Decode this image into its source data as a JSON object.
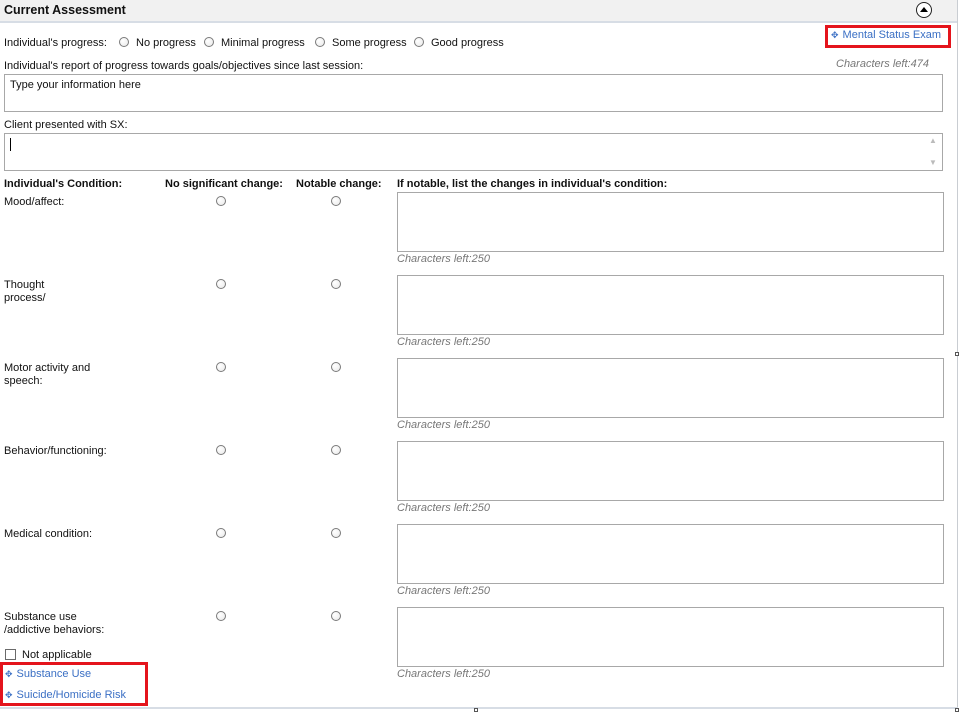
{
  "section": {
    "title": "Current Assessment"
  },
  "mental_status_exam": {
    "label": "Mental Status Exam"
  },
  "progress": {
    "label": "Individual's progress:",
    "options": [
      "No progress",
      "Minimal progress",
      "Some progress",
      "Good progress"
    ]
  },
  "report": {
    "label": "Individual's report of progress towards goals/objectives since last session:",
    "chars_left": "Characters left:474",
    "value": "Type your information here"
  },
  "sx": {
    "label": "Client presented with SX:"
  },
  "condition": {
    "headers": {
      "condition": "Individual's Condition:",
      "no_change": "No significant change:",
      "notable": "Notable change:",
      "list": "If notable, list the changes in individual's condition:"
    },
    "rows": [
      {
        "label": "Mood/affect:",
        "chars_left": "Characters left:250"
      },
      {
        "label": "Thought process/",
        "chars_left": "Characters left:250"
      },
      {
        "label": "Motor activity and speech:",
        "chars_left": "Characters left:250"
      },
      {
        "label": "Behavior/functioning:",
        "chars_left": "Characters left:250"
      },
      {
        "label": "Medical condition:",
        "chars_left": "Characters left:250"
      },
      {
        "label": "Substance use /addictive behaviors:",
        "chars_left": "Characters left:250"
      }
    ]
  },
  "not_applicable": {
    "label": "Not applicable"
  },
  "links": {
    "substance_use": "Substance Use",
    "suicide_risk": "Suicide/Homicide Risk"
  },
  "icons": {
    "link": "expand-icon",
    "collapse": "collapse-up-icon"
  },
  "colors": {
    "highlight": "#e4141c",
    "link": "#3a6fc4",
    "header_bg": "#f1f1f1"
  }
}
